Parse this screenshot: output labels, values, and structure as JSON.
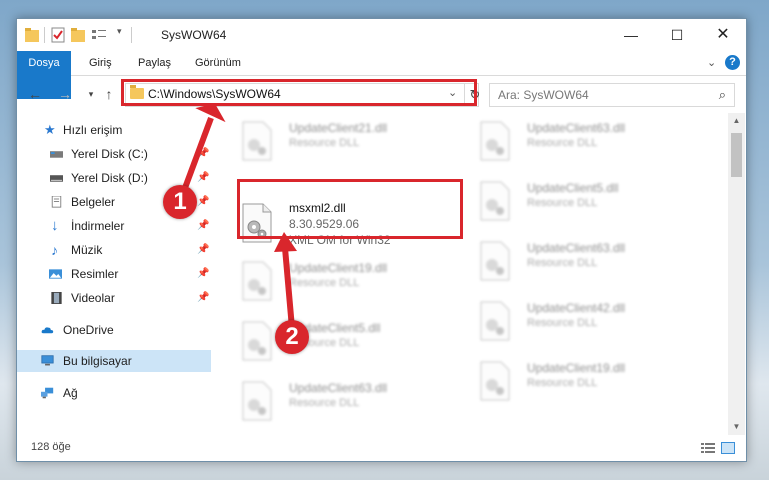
{
  "window": {
    "title": "SysWOW64"
  },
  "ribbon": {
    "tabs": [
      "Dosya",
      "Giriş",
      "Paylaş",
      "Görünüm"
    ]
  },
  "nav": {
    "address": "C:\\Windows\\SysWOW64",
    "search_placeholder": "Ara: SysWOW64"
  },
  "sidebar": {
    "items": [
      {
        "label": "Hızlı erişim",
        "icon": "star-icon",
        "pinned": false
      },
      {
        "label": "Yerel Disk (C:)",
        "icon": "drive-icon",
        "pinned": true
      },
      {
        "label": "Yerel Disk (D:)",
        "icon": "drive-icon",
        "pinned": true
      },
      {
        "label": "Belgeler",
        "icon": "documents-icon",
        "pinned": true
      },
      {
        "label": "İndirmeler",
        "icon": "download-icon",
        "pinned": true
      },
      {
        "label": "Müzik",
        "icon": "music-icon",
        "pinned": true
      },
      {
        "label": "Resimler",
        "icon": "pictures-icon",
        "pinned": true
      },
      {
        "label": "Videolar",
        "icon": "videos-icon",
        "pinned": true
      },
      {
        "label": "OneDrive",
        "icon": "cloud-icon",
        "pinned": false
      },
      {
        "label": "Bu bilgisayar",
        "icon": "computer-icon",
        "pinned": false,
        "selected": true
      },
      {
        "label": "Ağ",
        "icon": "network-icon",
        "pinned": false
      }
    ]
  },
  "files": {
    "highlight": {
      "name": "msxml2.dll",
      "version": "8.30.9529.06",
      "description": "XML OM for Win32"
    },
    "blurred": [
      {
        "name": "UpdateClient21.dll",
        "type": "Resource DLL"
      },
      {
        "name": "UpdateClient63.dll",
        "type": "Resource DLL"
      },
      {
        "name": "UpdateClient5.dll",
        "type": "Resource DLL"
      },
      {
        "name": "UpdateClient19.dll",
        "type": "Resource DLL"
      },
      {
        "name": "UpdateClient63.dll",
        "type": "Resource DLL"
      },
      {
        "name": "UpdateClient5.dll",
        "type": "Resource DLL"
      },
      {
        "name": "UpdateClient42.dll",
        "type": "Resource DLL"
      },
      {
        "name": "UpdateClient63.dll",
        "type": "Resource DLL"
      },
      {
        "name": "UpdateClient19.dll",
        "type": "Resource DLL"
      }
    ]
  },
  "status": {
    "count": "128 öğe"
  },
  "callouts": {
    "one": "1",
    "two": "2"
  },
  "colors": {
    "accent": "#1979ca",
    "highlight_red": "#d9262c",
    "selected_bg": "#cce4f7"
  }
}
